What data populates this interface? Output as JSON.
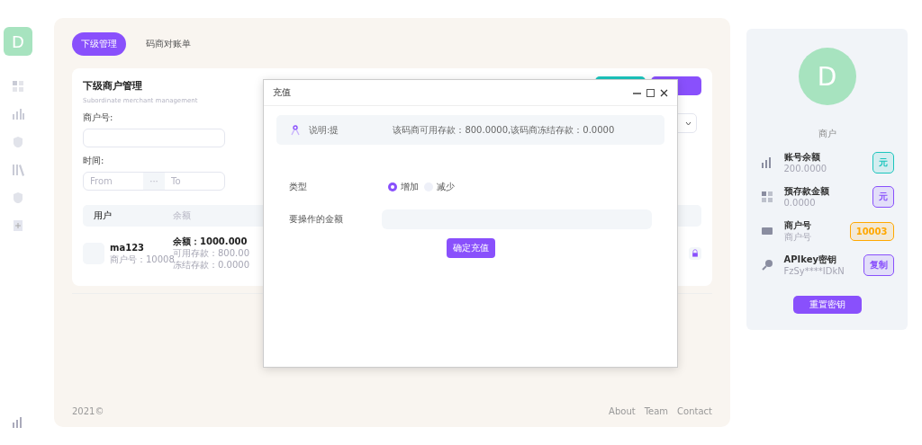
{
  "sidebar": {
    "logo": "D"
  },
  "tabs": [
    {
      "label": "下级管理",
      "selected": true
    },
    {
      "label": "码商对账单",
      "selected": false
    }
  ],
  "card": {
    "title": "下级商户管理",
    "subtitle": "Subordinate merchant management",
    "actions": [
      {
        "kind": "teal"
      },
      {
        "kind": "purple"
      }
    ],
    "filters": {
      "merchant_label": "商户号:",
      "time_label": "时间:",
      "from_placeholder": "From",
      "separator": "···",
      "to_placeholder": "To"
    },
    "table": {
      "columns": [
        "用户",
        "余额"
      ],
      "rows": [
        {
          "name": "ma123",
          "merchant_no": "商户号：10008",
          "balance": "余额：1000.000",
          "available": "可用存款：800.00",
          "frozen": "冻结存款：0.0000"
        }
      ]
    }
  },
  "footer": {
    "copyright": "2021©",
    "links": [
      "About",
      "Team",
      "Contact"
    ]
  },
  "dialog": {
    "title": "充值",
    "notice_start": "说明:提",
    "notice_end": "该码商可用存款：800.0000,该码商冻结存款：0.0000",
    "type_label": "类型",
    "options": [
      {
        "label": "增加",
        "selected": true
      },
      {
        "label": "减少",
        "selected": false
      }
    ],
    "amount_label": "要操作的金额",
    "submit": "确定充值"
  },
  "profile": {
    "avatar": "D",
    "role": "商户",
    "items": [
      {
        "kind": "chart",
        "title": "账号余额",
        "value": "200.0000",
        "badge": "元",
        "color": "#1bc5bd"
      },
      {
        "kind": "grid",
        "title": "预存款金额",
        "value": "0.0000",
        "badge": "元",
        "color": "#8950fc"
      },
      {
        "kind": "card",
        "title": "商户号",
        "value": "商户号",
        "badge": "10003",
        "color": "#ffa800"
      },
      {
        "kind": "key",
        "title": "APIkey密钥",
        "value": "FzSy****IDkN",
        "badge": "复制",
        "color": "#8950fc"
      }
    ],
    "reset": "重置密钥"
  }
}
